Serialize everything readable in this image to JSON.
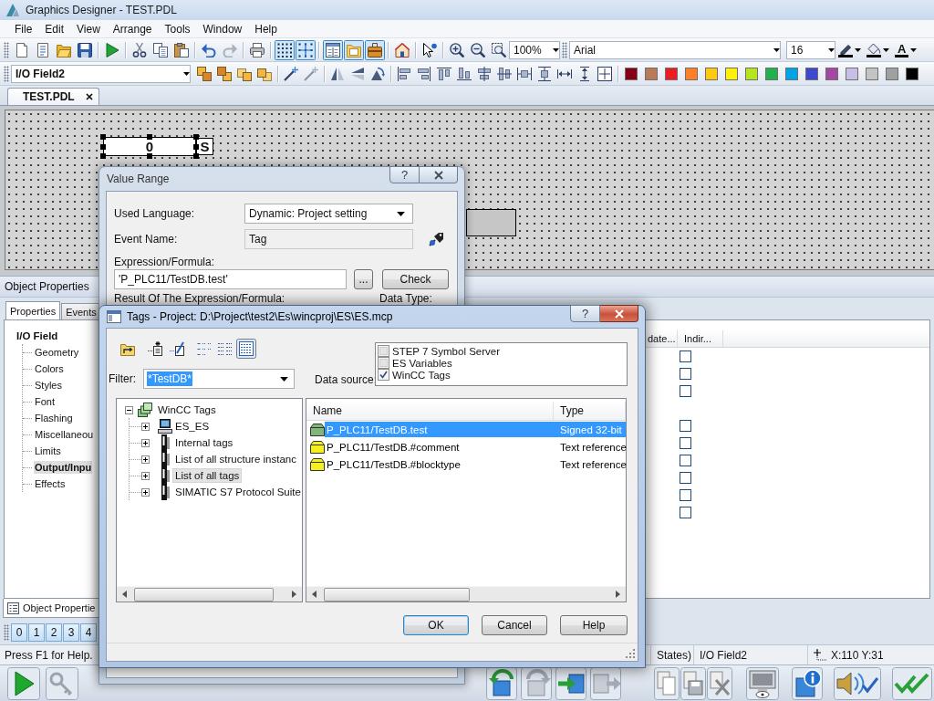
{
  "window": {
    "title": "Graphics Designer - TEST.PDL"
  },
  "menu": [
    "File",
    "Edit",
    "View",
    "Arrange",
    "Tools",
    "Window",
    "Help"
  ],
  "toolbar": {
    "toggles": [
      {
        "kind": "grid",
        "on": true
      },
      {
        "kind": "snap",
        "on": true
      },
      {
        "kind": "properties",
        "on": true
      },
      {
        "kind": "library",
        "on": true
      },
      {
        "kind": "toolbox",
        "on": true
      }
    ],
    "zoom": "100%",
    "font": "Arial",
    "font_size": "16",
    "font_color_label": "A"
  },
  "object_toolbar": {
    "object": "I/O Field2",
    "palette": [
      {
        "color": "#880015"
      },
      {
        "color": "#b97a57"
      },
      {
        "color": "#ed1c24"
      },
      {
        "color": "#ff7f27"
      },
      {
        "color": "#ffc90e"
      },
      {
        "color": "#fff200"
      },
      {
        "color": "#b5e61d"
      },
      {
        "color": "#22b14c"
      },
      {
        "color": "#00a2e8"
      },
      {
        "color": "#3f48cc"
      },
      {
        "color": "#a349a4"
      },
      {
        "color": "#c8bfe7"
      },
      {
        "color": "#c3c3c3"
      },
      {
        "color": "#a0a0a0"
      },
      {
        "color": "#000000"
      }
    ]
  },
  "document_tabs": [
    {
      "label": "TEST.PDL",
      "selected": true
    }
  ],
  "canvas": {
    "io_field": {
      "value": "0",
      "unit": "S",
      "selected": true
    }
  },
  "object_properties": {
    "title": "Object Properties",
    "tabs": [
      {
        "label": "Properties",
        "selected": true
      },
      {
        "label": "Events",
        "selected": false
      }
    ],
    "tree": {
      "label": "I/O Field",
      "children": [
        {
          "label": "Geometry",
          "selected": false,
          "dynamic": false
        },
        {
          "label": "Colors",
          "selected": false,
          "dynamic": false
        },
        {
          "label": "Styles",
          "selected": false,
          "dynamic": false
        },
        {
          "label": "Font",
          "selected": false,
          "dynamic": false
        },
        {
          "label": "Flashing",
          "selected": false,
          "dynamic": false
        },
        {
          "label": "Miscellaneou",
          "selected": false,
          "dynamic": false
        },
        {
          "label": "Limits",
          "selected": false,
          "dynamic": false
        },
        {
          "label": "Output/Inpu",
          "selected": true,
          "dynamic": true
        },
        {
          "label": "Effects",
          "selected": false,
          "dynamic": false
        }
      ]
    },
    "columns": [
      "date...",
      "Indir..."
    ],
    "rows": [
      {
        "kind": "check",
        "checked": false
      },
      {
        "kind": "check",
        "checked": false
      },
      {
        "kind": "check",
        "checked": false
      },
      {
        "kind": "group"
      },
      {
        "kind": "check",
        "checked": false
      },
      {
        "kind": "check",
        "checked": false
      },
      {
        "kind": "check",
        "checked": false
      },
      {
        "kind": "check",
        "checked": false
      },
      {
        "kind": "check",
        "checked": false
      },
      {
        "kind": "check",
        "checked": false
      }
    ],
    "footer_tab": "Object Propertie"
  },
  "layers": [
    {
      "label": "0",
      "on": true
    },
    {
      "label": "1",
      "on": true
    },
    {
      "label": "2",
      "on": true
    },
    {
      "label": "3",
      "on": true
    },
    {
      "label": "4",
      "on": true
    }
  ],
  "status_bar": {
    "help": "Press F1 for Help.",
    "segment": "States)",
    "object": "I/O Field2",
    "position": "X:110 Y:31"
  },
  "value_range": {
    "title": "Value Range",
    "help_button": "?",
    "used_language": {
      "label": "Used Language:",
      "value": "Dynamic: Project setting"
    },
    "event_name": {
      "label": "Event Name:",
      "value": "Tag",
      "read_only": true
    },
    "expression": {
      "label": "Expression/Formula:",
      "value": "'P_PLC11/TestDB.test'",
      "browse_button": "...",
      "check_button": "Check"
    },
    "result_label": "Result Of The Expression/Formula:",
    "data_type_label": "Data Type:"
  },
  "tags_dialog": {
    "title": "Tags - Project: D:\\Project\\test2\\Es\\wincproj\\ES\\ES.mcp",
    "help_button": "?",
    "view_modes": [
      {
        "kind": "small_icons",
        "selected": false
      },
      {
        "kind": "list",
        "selected": false
      },
      {
        "kind": "details",
        "selected": true
      }
    ],
    "filter": {
      "label": "Filter:",
      "value": "*TestDB*",
      "highlighted": true
    },
    "data_source": {
      "label": "Data source:",
      "items": [
        {
          "label": "STEP 7 Symbol Server",
          "checked": false
        },
        {
          "label": "ES Variables",
          "checked": false
        },
        {
          "label": "WinCC Tags",
          "checked": true
        }
      ]
    },
    "tree": {
      "label": "WinCC Tags",
      "expanded": true,
      "selected": false,
      "children": [
        {
          "label": "ES_ES",
          "kind": "computer",
          "expanded": false,
          "selected": false
        },
        {
          "label": "Internal tags",
          "kind": "connection",
          "expanded": false,
          "selected": false
        },
        {
          "label": "List of all structure instanc",
          "kind": "connection",
          "expanded": false,
          "selected": false
        },
        {
          "label": "List of all tags",
          "kind": "connection",
          "expanded": false,
          "selected": true
        },
        {
          "label": "SIMATIC S7 Protocol Suite",
          "kind": "connection",
          "expanded": false,
          "selected": false
        }
      ]
    },
    "list": {
      "columns": [
        "Name",
        "Type"
      ],
      "rows": [
        {
          "name": "P_PLC11/TestDB.test",
          "type": "Signed 32-bit",
          "kind": "analog",
          "selected": true
        },
        {
          "name": "P_PLC11/TestDB.#comment",
          "type": "Text reference",
          "kind": "text",
          "selected": false
        },
        {
          "name": "P_PLC11/TestDB.#blocktype",
          "type": "Text reference",
          "kind": "text",
          "selected": false
        }
      ]
    },
    "buttons": [
      {
        "label": "OK",
        "default": true
      },
      {
        "label": "Cancel",
        "default": false
      },
      {
        "label": "Help",
        "default": false
      }
    ]
  }
}
